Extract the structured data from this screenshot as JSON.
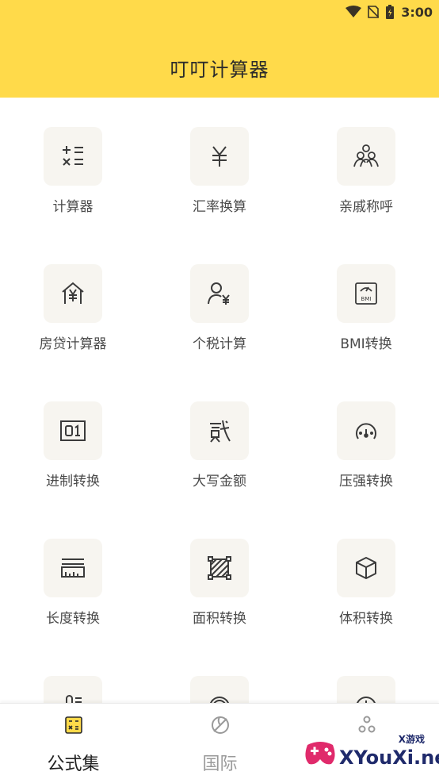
{
  "status_bar": {
    "time": "3:00"
  },
  "header": {
    "title": "叮叮计算器"
  },
  "colors": {
    "accent": "#FFDA4A",
    "tile_bg": "#F7F5F0",
    "nav_active": "#222222",
    "nav_inactive": "#9a9a9a"
  },
  "tools": [
    {
      "label": "计算器",
      "icon": "calculator-operators-icon"
    },
    {
      "label": "汇率换算",
      "icon": "yuan-icon"
    },
    {
      "label": "亲戚称呼",
      "icon": "family-icon"
    },
    {
      "label": "房贷计算器",
      "icon": "house-yuan-icon"
    },
    {
      "label": "个税计算",
      "icon": "person-yuan-icon"
    },
    {
      "label": "BMI转换",
      "icon": "bmi-scale-icon"
    },
    {
      "label": "进制转换",
      "icon": "binary-icon"
    },
    {
      "label": "大写金额",
      "icon": "chinese-numeral-icon"
    },
    {
      "label": "压强转换",
      "icon": "gauge-icon"
    },
    {
      "label": "长度转换",
      "icon": "ruler-icon"
    },
    {
      "label": "面积转换",
      "icon": "area-icon"
    },
    {
      "label": "体积转换",
      "icon": "cube-icon"
    },
    {
      "label": "",
      "icon": "temperature-icon"
    },
    {
      "label": "",
      "icon": "speed-icon"
    },
    {
      "label": "",
      "icon": "time-icon"
    }
  ],
  "bottom_nav": [
    {
      "label": "公式集",
      "icon": "formula-icon",
      "active": true
    },
    {
      "label": "国际",
      "icon": "leaf-icon",
      "active": false
    },
    {
      "label": "",
      "icon": "apps-icon",
      "active": false
    }
  ],
  "watermark": {
    "text": "XYouXi.net",
    "sub": "X游戏"
  }
}
